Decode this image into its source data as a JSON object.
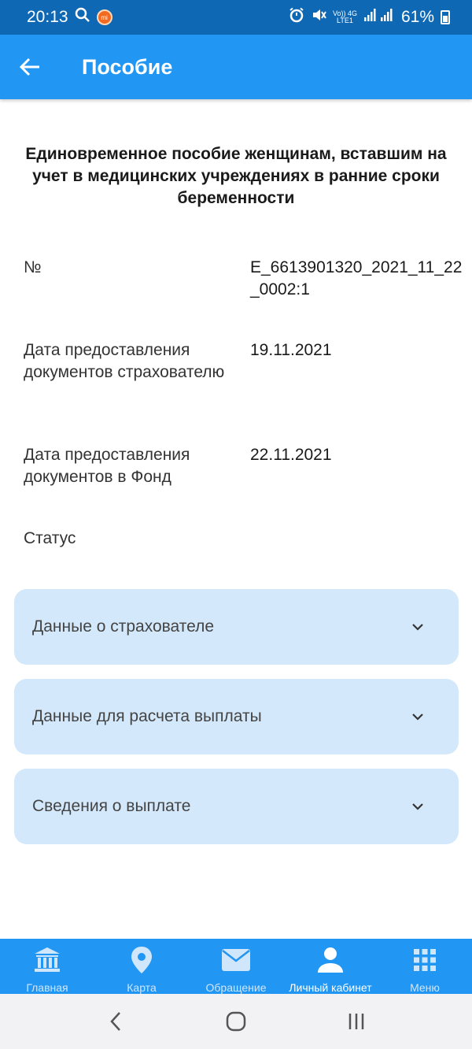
{
  "status_bar": {
    "time": "20:13",
    "network_top": "Vo)) 4G",
    "network_bottom": "LTE1",
    "battery": "61%"
  },
  "header": {
    "title": "Пособие"
  },
  "main": {
    "heading": "Единовременное пособие женщинам, вставшим на учет в медицинских учреждениях в ранние сроки беременности",
    "fields": [
      {
        "label": "№",
        "value": "Е_6613901320_2021_11_22_0002:1"
      },
      {
        "label": "Дата предоставления документов страхователю",
        "value": "19.11.2021"
      },
      {
        "label": "Дата предоставления документов в Фонд",
        "value": "22.11.2021"
      },
      {
        "label": "Статус",
        "value": ""
      }
    ],
    "sections": [
      {
        "label": "Данные о страхователе"
      },
      {
        "label": "Данные для расчета выплаты"
      },
      {
        "label": "Сведения о выплате"
      }
    ]
  },
  "bottom_nav": {
    "items": [
      {
        "label": "Главная",
        "icon": "bank-icon"
      },
      {
        "label": "Карта",
        "icon": "map-pin-icon"
      },
      {
        "label": "Обращение",
        "icon": "mail-icon"
      },
      {
        "label": "Личный кабинет",
        "icon": "person-icon",
        "active": true
      },
      {
        "label": "Меню",
        "icon": "grid-icon"
      }
    ]
  },
  "colors": {
    "status_bar": "#0f68b4",
    "primary": "#2196f3",
    "accordion_bg": "#d3e8fb"
  }
}
